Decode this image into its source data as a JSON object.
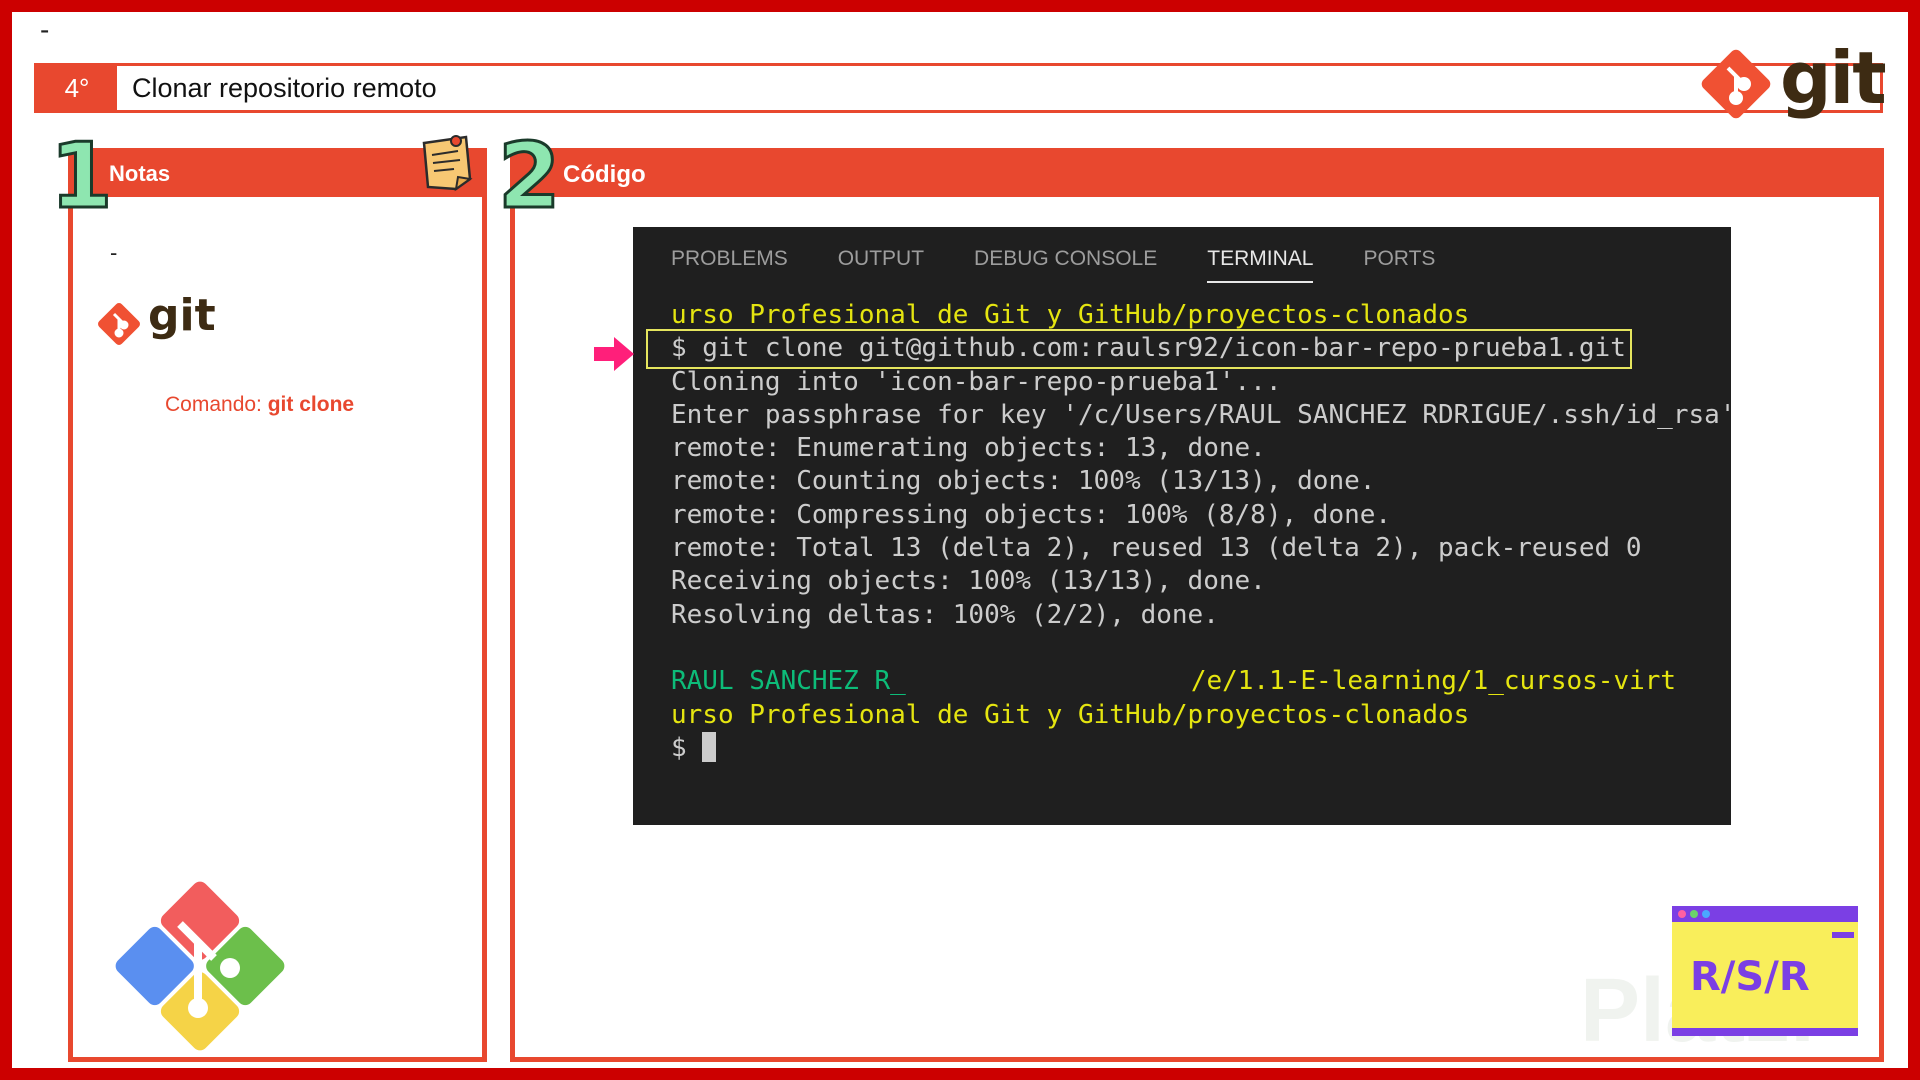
{
  "slide": {
    "top_dash": "-",
    "step_number": "4°",
    "title": "Clonar repositorio remoto",
    "brand_word": "git"
  },
  "notes": {
    "number": "1",
    "header": "Notas",
    "dash": "-",
    "git_word": "git",
    "command_label": "Comando:",
    "command_value": "git clone"
  },
  "code": {
    "number": "2",
    "header": "Código"
  },
  "terminal": {
    "tabs": [
      {
        "label": "PROBLEMS",
        "active": false
      },
      {
        "label": "OUTPUT",
        "active": false
      },
      {
        "label": "DEBUG CONSOLE",
        "active": false
      },
      {
        "label": "TERMINAL",
        "active": true
      },
      {
        "label": "PORTS",
        "active": false
      }
    ],
    "lines": [
      "urso Profesional de Git y GitHub/proyectos-clonados",
      "$ git clone git@github.com:raulsr92/icon-bar-repo-prueba1.git",
      "Cloning into 'icon-bar-repo-prueba1'...",
      "Enter passphrase for key '/c/Users/RAUL SANCHEZ RDRIGUE/.ssh/id_rsa':",
      "remote: Enumerating objects: 13, done.",
      "remote: Counting objects: 100% (13/13), done.",
      "remote: Compressing objects: 100% (8/8), done.",
      "remote: Total 13 (delta 2), reused 13 (delta 2), pack-reused 0",
      "Receiving objects: 100% (13/13), done.",
      "Resolving deltas: 100% (2/2), done.",
      "",
      "RAUL SANCHEZ R_",
      "/e/1.1-E-learning/1_cursos-virt",
      "urso Profesional de Git y GitHub/proyectos-clonados",
      "$"
    ]
  },
  "badge": {
    "text": "R/S/R"
  },
  "watermark": "Platzi",
  "colors": {
    "frame": "#cc0000",
    "accent": "#e8482f",
    "terminal_bg": "#1f1f1f",
    "terminal_yellow": "#e5e510",
    "terminal_green": "#0dbc79",
    "arrow": "#ff1f7a"
  }
}
